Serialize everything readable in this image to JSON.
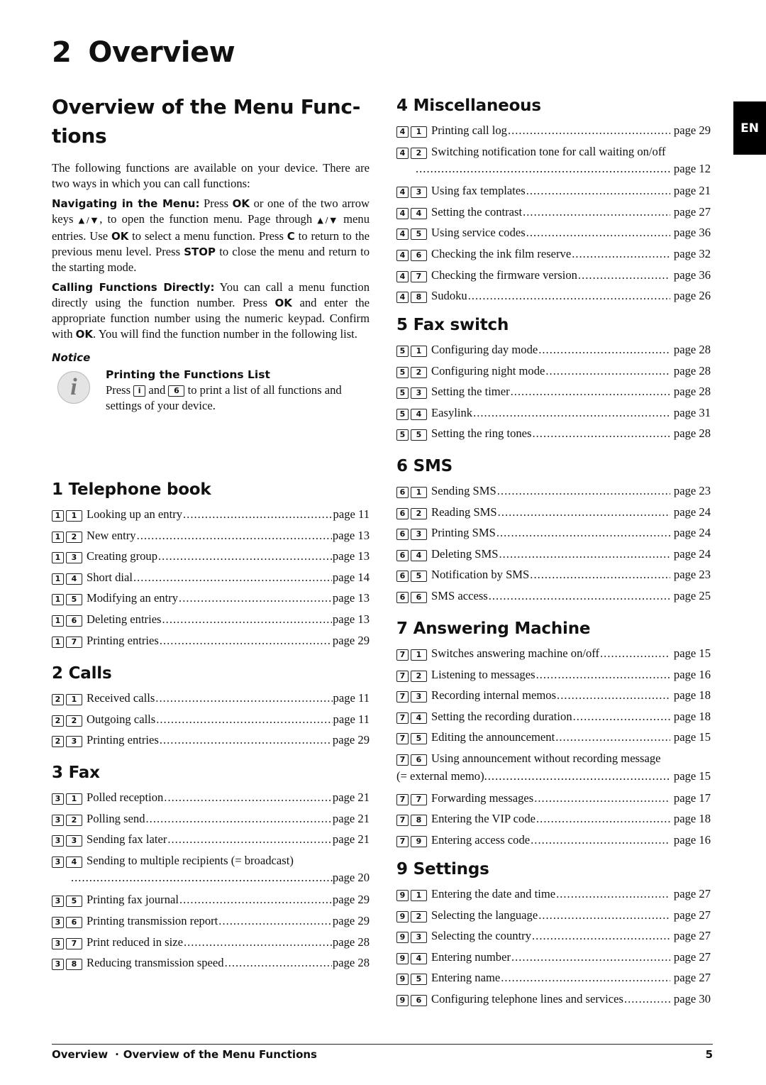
{
  "chapter": {
    "number": "2",
    "title": "Overview"
  },
  "intro": {
    "heading": "Overview of the Menu Func- tions",
    "heading_line1": "Overview of the Menu Func-",
    "heading_line2": "tions",
    "paragraph": "The following functions are available on your device. There are two ways in which you can call functions:",
    "navigating": {
      "label": "Navigating in the Menu:",
      "t1": " Press ",
      "k1": "OK",
      "t2": " or one of the two arrow keys ",
      "arrows": "▲/▼",
      "t3": ", to open the function menu. Page through ",
      "t4": " menu entries. Use ",
      "k2": "OK",
      "t5": " to select a menu function. Press ",
      "k3": "C",
      "t6": " to return to the previous menu level. Press ",
      "k4": "STOP",
      "t7": " to close the menu and return to the starting mode."
    },
    "calling": {
      "label": "Calling Functions Directly:",
      "t1": " You can call a menu function directly using the function number. Press ",
      "k1": "OK",
      "t2": " and enter the appropriate function number using the numeric keypad. Confirm with ",
      "k2": "OK",
      "t3": ". You will find the function number in the following list."
    },
    "notice": {
      "label": "Notice",
      "icon": "info-icon",
      "title": "Printing the Functions List",
      "t1": "Press ",
      "key1": "i",
      "t2": " and ",
      "key2": "6",
      "t3": " to print a list of all functions and settings of your device."
    }
  },
  "sections": {
    "telephone_book": {
      "title": "1 Telephone book",
      "entries": [
        {
          "keys": [
            "1",
            "1"
          ],
          "label": "Looking up an entry",
          "page": "page 11"
        },
        {
          "keys": [
            "1",
            "2"
          ],
          "label": "New entry",
          "page": "page 13"
        },
        {
          "keys": [
            "1",
            "3"
          ],
          "label": "Creating group",
          "page": "page 13"
        },
        {
          "keys": [
            "1",
            "4"
          ],
          "label": "Short dial",
          "page": "page 14"
        },
        {
          "keys": [
            "1",
            "5"
          ],
          "label": "Modifying an entry",
          "page": "page 13"
        },
        {
          "keys": [
            "1",
            "6"
          ],
          "label": "Deleting entries",
          "page": "page 13"
        },
        {
          "keys": [
            "1",
            "7"
          ],
          "label": "Printing entries",
          "page": "page 29"
        }
      ]
    },
    "calls": {
      "title": "2 Calls",
      "entries": [
        {
          "keys": [
            "2",
            "1"
          ],
          "label": "Received calls",
          "page": "page 11"
        },
        {
          "keys": [
            "2",
            "2"
          ],
          "label": "Outgoing calls",
          "page": "page 11"
        },
        {
          "keys": [
            "2",
            "3"
          ],
          "label": "Printing entries",
          "page": "page 29"
        }
      ]
    },
    "fax": {
      "title": "3 Fax",
      "entries": [
        {
          "keys": [
            "3",
            "1"
          ],
          "label": "Polled reception",
          "page": "page 21"
        },
        {
          "keys": [
            "3",
            "2"
          ],
          "label": "Polling send",
          "page": "page 21"
        },
        {
          "keys": [
            "3",
            "3"
          ],
          "label": "Sending fax later",
          "page": "page 21"
        },
        {
          "keys": [
            "3",
            "4"
          ],
          "label": "Sending to multiple recipients (= broadcast)",
          "page": "page 20"
        },
        {
          "keys": [
            "3",
            "5"
          ],
          "label": "Printing fax journal",
          "page": "page 29"
        },
        {
          "keys": [
            "3",
            "6"
          ],
          "label": "Printing transmission report",
          "page": "page 29"
        },
        {
          "keys": [
            "3",
            "7"
          ],
          "label": "Print reduced in size",
          "page": "page 28"
        },
        {
          "keys": [
            "3",
            "8"
          ],
          "label": "Reducing transmission speed",
          "page": "page 28"
        }
      ]
    },
    "miscellaneous": {
      "title": "4 Miscellaneous",
      "entries": [
        {
          "keys": [
            "4",
            "1"
          ],
          "label": "Printing call log",
          "page": "page 29"
        },
        {
          "keys": [
            "4",
            "2"
          ],
          "label": "Switching notification tone for call waiting on/off",
          "page": "page 12"
        },
        {
          "keys": [
            "4",
            "3"
          ],
          "label": "Using fax templates",
          "page": "page 21"
        },
        {
          "keys": [
            "4",
            "4"
          ],
          "label": "Setting the contrast",
          "page": "page 27"
        },
        {
          "keys": [
            "4",
            "5"
          ],
          "label": "Using service codes",
          "page": "page 36"
        },
        {
          "keys": [
            "4",
            "6"
          ],
          "label": "Checking the ink film reserve",
          "page": "page 32"
        },
        {
          "keys": [
            "4",
            "7"
          ],
          "label": "Checking the firmware version",
          "page": "page 36"
        },
        {
          "keys": [
            "4",
            "8"
          ],
          "label": "Sudoku",
          "page": "page 26"
        }
      ]
    },
    "fax_switch": {
      "title": "5 Fax switch",
      "entries": [
        {
          "keys": [
            "5",
            "1"
          ],
          "label": "Configuring day mode",
          "page": "page 28"
        },
        {
          "keys": [
            "5",
            "2"
          ],
          "label": "Configuring night mode",
          "page": "page 28"
        },
        {
          "keys": [
            "5",
            "3"
          ],
          "label": "Setting the timer",
          "page": "page 28"
        },
        {
          "keys": [
            "5",
            "4"
          ],
          "label": "Easylink",
          "page": "page 31"
        },
        {
          "keys": [
            "5",
            "5"
          ],
          "label": "Setting the ring tones",
          "page": "page 28"
        }
      ]
    },
    "sms": {
      "title": "6 SMS",
      "entries": [
        {
          "keys": [
            "6",
            "1"
          ],
          "label": "Sending SMS",
          "page": "page 23"
        },
        {
          "keys": [
            "6",
            "2"
          ],
          "label": "Reading SMS",
          "page": "page 24"
        },
        {
          "keys": [
            "6",
            "3"
          ],
          "label": "Printing SMS",
          "page": "page 24"
        },
        {
          "keys": [
            "6",
            "4"
          ],
          "label": "Deleting SMS",
          "page": "page 24"
        },
        {
          "keys": [
            "6",
            "5"
          ],
          "label": "Notification by SMS",
          "page": "page 23"
        },
        {
          "keys": [
            "6",
            "6"
          ],
          "label": "SMS access",
          "page": "page 25"
        }
      ]
    },
    "answering_machine": {
      "title": "7 Answering Machine",
      "entries": [
        {
          "keys": [
            "7",
            "1"
          ],
          "label": "Switches answering machine on/off",
          "page": "page 15"
        },
        {
          "keys": [
            "7",
            "2"
          ],
          "label": "Listening to messages",
          "page": "page 16"
        },
        {
          "keys": [
            "7",
            "3"
          ],
          "label": "Recording internal memos",
          "page": "page 18"
        },
        {
          "keys": [
            "7",
            "4"
          ],
          "label": "Setting the recording duration",
          "page": "page 18"
        },
        {
          "keys": [
            "7",
            "5"
          ],
          "label": "Editing the announcement",
          "page": "page 15"
        },
        {
          "keys": [
            "7",
            "6"
          ],
          "label": "Using announcement without recording message",
          "label_cont": "(= external memo)",
          "page": "page 15"
        },
        {
          "keys": [
            "7",
            "7"
          ],
          "label": "Forwarding messages",
          "page": "page 17"
        },
        {
          "keys": [
            "7",
            "8"
          ],
          "label": "Entering the VIP code",
          "page": "page 18"
        },
        {
          "keys": [
            "7",
            "9"
          ],
          "label": "Entering access code",
          "page": "page 16"
        }
      ]
    },
    "settings": {
      "title": "9 Settings",
      "entries": [
        {
          "keys": [
            "9",
            "1"
          ],
          "label": "Entering the date and time",
          "page": "page 27"
        },
        {
          "keys": [
            "9",
            "2"
          ],
          "label": "Selecting the language",
          "page": "page 27"
        },
        {
          "keys": [
            "9",
            "3"
          ],
          "label": "Selecting the country",
          "page": "page 27"
        },
        {
          "keys": [
            "9",
            "4"
          ],
          "label": "Entering number",
          "page": "page 27"
        },
        {
          "keys": [
            "9",
            "5"
          ],
          "label": "Entering name",
          "page": "page 27"
        },
        {
          "keys": [
            "9",
            "6"
          ],
          "label": "Configuring telephone lines and services",
          "page": "page 30"
        }
      ]
    }
  },
  "language_tab": "EN",
  "footer": {
    "chapter": "Overview",
    "separator": "·",
    "section": "Overview of the Menu Functions",
    "page_number": "5"
  }
}
